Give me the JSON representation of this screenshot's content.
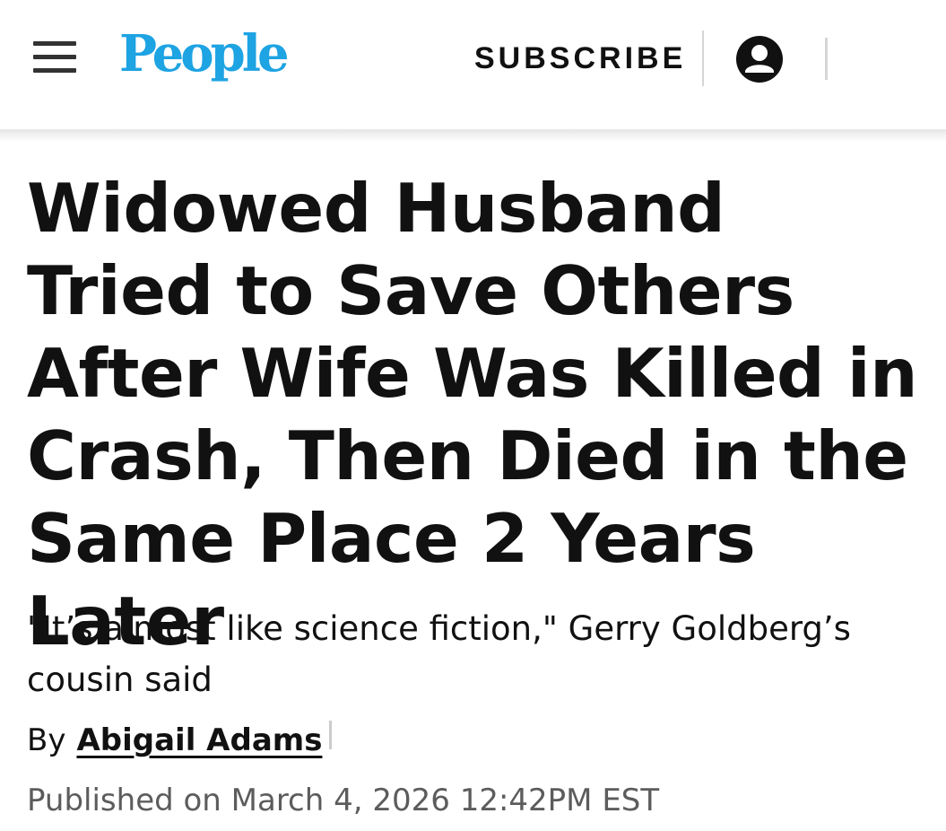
{
  "header": {
    "menu_icon": "hamburger-menu-icon",
    "logo_text": "People",
    "logo_color": "#1ea3e3",
    "subscribe_label": "SUBSCRIBE",
    "account_icon": "user-account-icon"
  },
  "article": {
    "headline": "Widowed Husband Tried to Save Others After Wife Was Killed in Crash, Then Died in the Same Place 2 Years Later",
    "dek": "\"It’s almost like science fiction,\" Gerry Goldberg’s cousin said",
    "byline_prefix": "By",
    "author": "Abigail Adams",
    "published": "Published on March 4, 2026 12:42PM EST"
  }
}
